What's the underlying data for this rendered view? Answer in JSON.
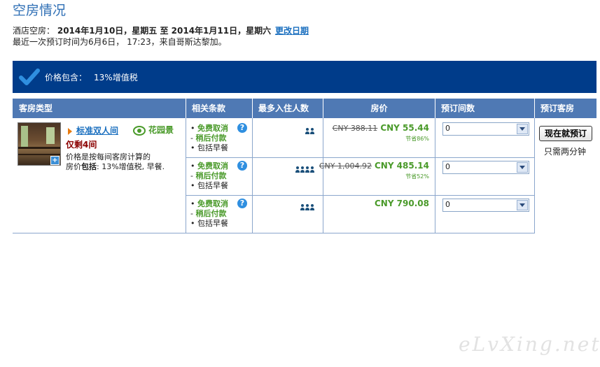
{
  "page_title": "空房情况",
  "availability": {
    "label": "酒店空房：",
    "range": "2014年1月10日，星期五 至 2014年1月11日，星期六",
    "change_date_link": "更改日期",
    "last_booking": "最近一次预订时间为6月6日， 17:23，来自哥斯达黎加。"
  },
  "price_banner": {
    "label": "价格包含：",
    "value": "13%增值税"
  },
  "table": {
    "headers": [
      "客房类型",
      "相关条款",
      "最多入住人数",
      "房价",
      "预订间数",
      "预订客房"
    ]
  },
  "room": {
    "name": "标准双人间",
    "view": "花园景",
    "remaining": "仅剩4间",
    "price_note_line1": "价格是按每间客房计算的",
    "price_note_line2_prefix": "房价",
    "price_note_line2_bold": "包括",
    "price_note_line2_rest": ": 13%增值税, 早餐."
  },
  "offers": [
    {
      "free_cancel": "免费取消",
      "pay_later": "稍后付款",
      "breakfast": "包括早餐",
      "occupancy": 2,
      "old_price": "CNY 388.11",
      "new_price": "CNY 55.44",
      "saving": "节省86%",
      "quantity": "0"
    },
    {
      "free_cancel": "免费取消",
      "pay_later": "稍后付款",
      "breakfast": "包括早餐",
      "occupancy": 4,
      "old_price": "CNY 1,004.92",
      "new_price": "CNY 485.14",
      "saving": "节省52%",
      "quantity": "0"
    },
    {
      "free_cancel": "免费取消",
      "pay_later": "稍后付款",
      "breakfast": "包括早餐",
      "occupancy": 3,
      "old_price": "",
      "new_price": "CNY 790.08",
      "saving": "",
      "quantity": "0"
    }
  ],
  "book_button": "现在就预订",
  "book_note": "只需两分钟",
  "watermark": "eLvXing.net",
  "colors": {
    "banner": "#003c8a",
    "header": "#4f79b4",
    "green": "#4a9a2a",
    "link": "#1a6fbf"
  }
}
